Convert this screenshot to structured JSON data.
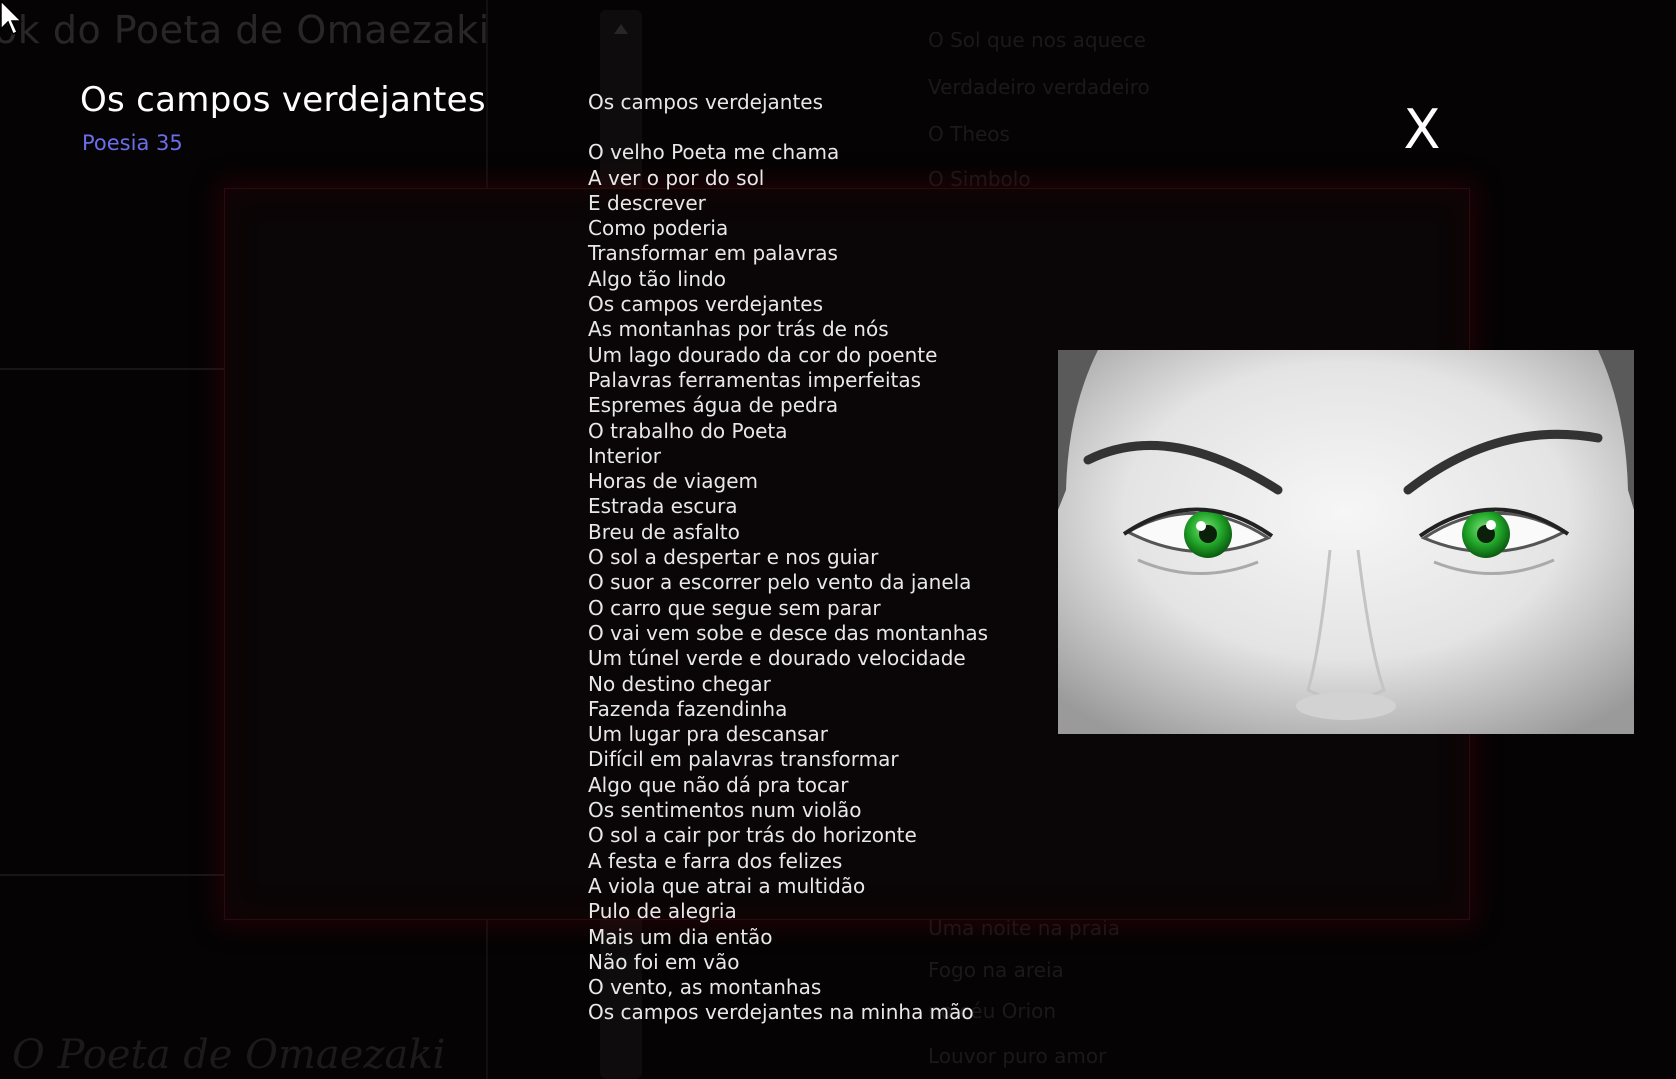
{
  "background": {
    "site_title": "ok do Poeta de Omaezaki",
    "footer_title": "O Poeta de Omaezaki",
    "menu_items": [
      "O Sol que nos aquece",
      "Verdadeiro verdadeiro",
      "O Theos",
      "O Simbolo",
      "Uma noite na praia",
      "Fogo na areia",
      "no céu Orion",
      "Louvor puro amor"
    ]
  },
  "poem": {
    "title": "Os campos verdejantes",
    "subtitle": "Poesia 35",
    "heading": "Os campos verdejantes",
    "lines": [
      "O velho Poeta me chama",
      "A ver o por do sol",
      "E descrever",
      "Como poderia",
      "Transformar em palavras",
      "Algo tão lindo",
      "Os campos verdejantes",
      "As montanhas por trás de nós",
      "Um lago dourado da cor do poente",
      "Palavras ferramentas imperfeitas",
      "Espremes água de pedra",
      "O trabalho do Poeta",
      "Interior",
      "Horas de viagem",
      "Estrada escura",
      "Breu de asfalto",
      "O sol a despertar e nos guiar",
      "O suor a escorrer pelo vento da janela",
      "O carro que segue sem parar",
      "O vai vem sobe e desce das montanhas",
      "Um túnel verde e dourado velocidade",
      "No destino chegar",
      "Fazenda fazendinha",
      "Um lugar pra descansar",
      "Difícil em palavras transformar",
      "Algo que não dá pra tocar",
      "Os sentimentos num violão",
      "O sol a cair por trás do horizonte",
      "A festa e farra dos felizes",
      "A viola que atrai a multidão",
      "Pulo de alegria",
      "Mais um dia então",
      "Não foi em vão",
      "O vento, as montanhas",
      "Os campos verdejantes na minha mão"
    ]
  },
  "close_label": "X",
  "colors": {
    "subtitle": "#6a6ee8",
    "eyes": "#22a82a",
    "frame": "#2a0c10"
  }
}
